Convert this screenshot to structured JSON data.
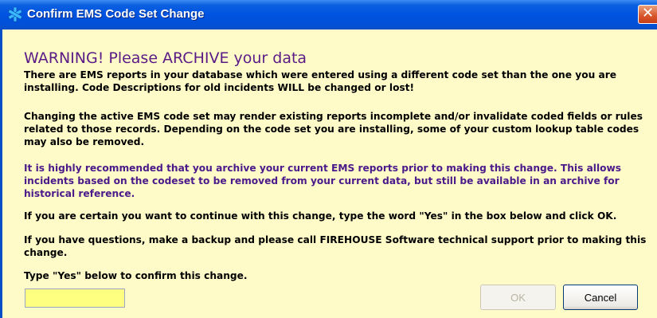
{
  "window": {
    "title": "Confirm EMS Code Set Change",
    "close_label": "✕"
  },
  "message": {
    "warning": "WARNING!  Please ARCHIVE your data",
    "paragraph1": "There are EMS reports in your database which were entered using a different code set than the one you are installing.  Code Descriptions for old incidents WILL be changed or lost!",
    "paragraph2": "Changing the active EMS code set may render existing reports incomplete and/or invalidate coded fields or rules related to those records. Depending on the code set you are installing, some of your custom lookup table codes may also be removed.",
    "paragraph3": "It is highly recommended that you archive your current EMS reports prior to making this change.  This allows incidents based on the codeset to be removed from your current data, but still be available in an archive for historical reference.",
    "paragraph4": "If you are certain you want to continue with this change, type the word \"Yes\" in the box below and click OK.",
    "paragraph5": "If you have questions, make a backup and please call FIREHOUSE Software technical support prior to making this change."
  },
  "confirm": {
    "label": "Type \"Yes\" below to confirm this change.",
    "value": ""
  },
  "buttons": {
    "ok": "OK",
    "cancel": "Cancel"
  },
  "colors": {
    "background": "#fffbc8",
    "warning_text": "#5a1b86",
    "input_bg": "#fefe80"
  }
}
